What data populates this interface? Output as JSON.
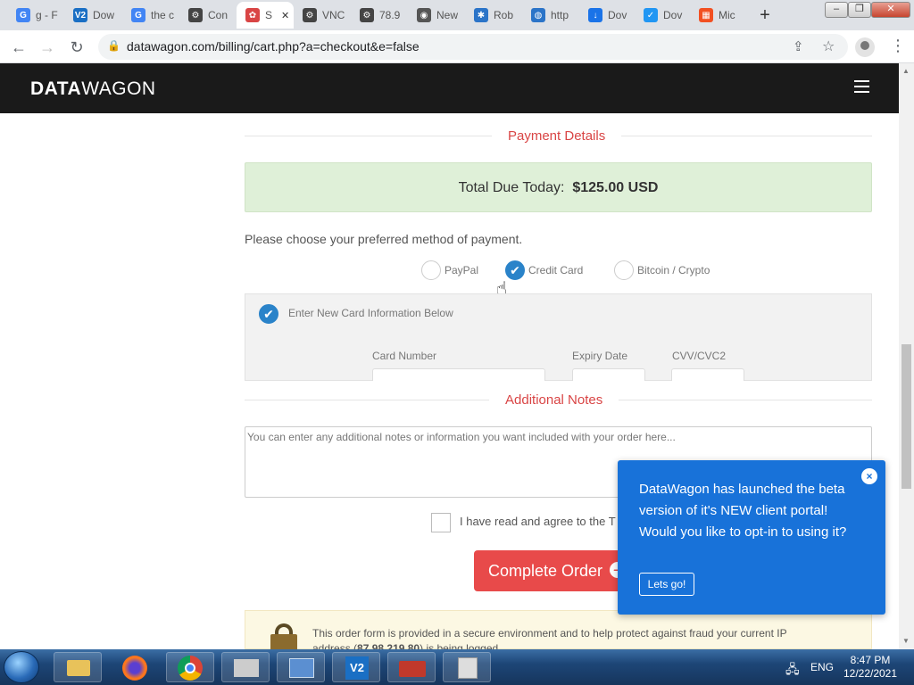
{
  "browser": {
    "tabs": [
      {
        "label": "g - F",
        "favicon": "G",
        "color": "#4285f4"
      },
      {
        "label": "Dow",
        "favicon": "V2",
        "color": "#1a6fc4"
      },
      {
        "label": "the c",
        "favicon": "G",
        "color": "#4285f4"
      },
      {
        "label": "Con",
        "favicon": "⚙",
        "color": "#444"
      },
      {
        "label": "S",
        "favicon": "✿",
        "color": "#d94545",
        "active": true
      },
      {
        "label": "VNC",
        "favicon": "⚙",
        "color": "#444"
      },
      {
        "label": "78.9",
        "favicon": "⚙",
        "color": "#444"
      },
      {
        "label": "New",
        "favicon": "◉",
        "color": "#555"
      },
      {
        "label": "Rob",
        "favicon": "✱",
        "color": "#2b74c8"
      },
      {
        "label": "http",
        "favicon": "◍",
        "color": "#2b74c8"
      },
      {
        "label": "Dov",
        "favicon": "↓",
        "color": "#1a73e8"
      },
      {
        "label": "Dov",
        "favicon": "✓",
        "color": "#2196f3"
      },
      {
        "label": "Mic",
        "favicon": "▦",
        "color": "#f25022"
      }
    ],
    "new_tab": "+",
    "url": "datawagon.com/billing/cart.php?a=checkout&e=false"
  },
  "site": {
    "logo_bold": "DATA",
    "logo_rest": "WAGON"
  },
  "checkout": {
    "payment_title": "Payment Details",
    "total_label": "Total Due Today:",
    "total_value": "$125.00 USD",
    "choose_method": "Please choose your preferred method of payment.",
    "methods": [
      {
        "label": "PayPal",
        "selected": false
      },
      {
        "label": "Credit Card",
        "selected": true
      },
      {
        "label": "Bitcoin / Crypto",
        "selected": false
      }
    ],
    "new_card_label": "Enter New Card Information Below",
    "card_number_label": "Card Number",
    "expiry_label": "Expiry Date",
    "cvv_label": "CVV/CVC2",
    "notes_title": "Additional Notes",
    "notes_placeholder": "You can enter any additional notes or information you want included with your order here...",
    "agree_text": "I have read and agree to the T",
    "complete_button": "Complete Order",
    "secure_line1": "This order form is provided in a secure environment and to help protect against fraud your current IP",
    "secure_line2_prefix": "address (",
    "secure_ip": "87.98.219.80",
    "secure_line2_suffix": ") is being logged."
  },
  "popup": {
    "message": "DataWagon has launched the beta version of it's NEW client portal! Would you like to opt-in to using it?",
    "button": "Lets go!",
    "close": "×"
  },
  "taskbar": {
    "language": "ENG",
    "time": "8:47 PM",
    "date": "12/22/2021"
  }
}
